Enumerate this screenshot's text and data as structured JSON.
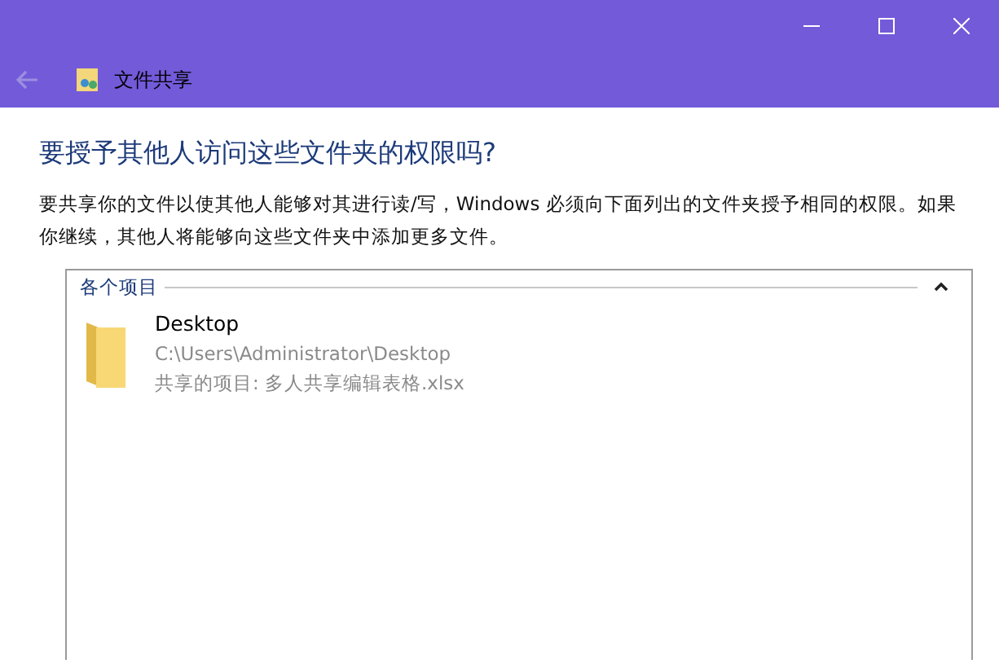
{
  "window": {
    "title": "文件共享"
  },
  "heading": "要授予其他人访问这些文件夹的权限吗?",
  "description": "要共享你的文件以使其他人能够对其进行读/写，Windows 必须向下面列出的文件夹授予相同的权限。如果你继续，其他人将能够向这些文件夹中添加更多文件。",
  "list": {
    "group": "各个项目",
    "expanded": true,
    "items": [
      {
        "name": "Desktop",
        "path": "C:\\Users\\Administrator\\Desktop",
        "shared": "共享的项目: 多人共享编辑表格.xlsx"
      }
    ]
  }
}
